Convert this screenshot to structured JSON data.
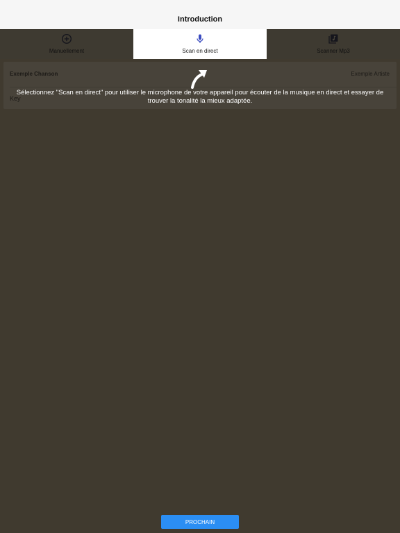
{
  "nav": {
    "title": "Introduction"
  },
  "tabs": [
    {
      "label": "Manuellement",
      "icon": "plus-circle-icon",
      "active": false
    },
    {
      "label": "Scan en direct",
      "icon": "microphone-icon",
      "active": true
    },
    {
      "label": "Scanner Mp3",
      "icon": "music-library-icon",
      "active": false
    }
  ],
  "song": {
    "title": "Exemple Chanson",
    "artist": "Exemple Artiste",
    "key_label": "Key"
  },
  "overlay": {
    "text": "Sélectionnez \"Scan en direct\" pour utiliser le microphone de votre appareil pour écouter de la musique en direct et essayer de trouver la tonalité la mieux adaptée."
  },
  "footer": {
    "next_label": "PROCHAIN"
  },
  "colors": {
    "overlay_bg": "#403a2f",
    "active_tab_icon": "#3b4cc0",
    "button": "#2b8ef4"
  }
}
